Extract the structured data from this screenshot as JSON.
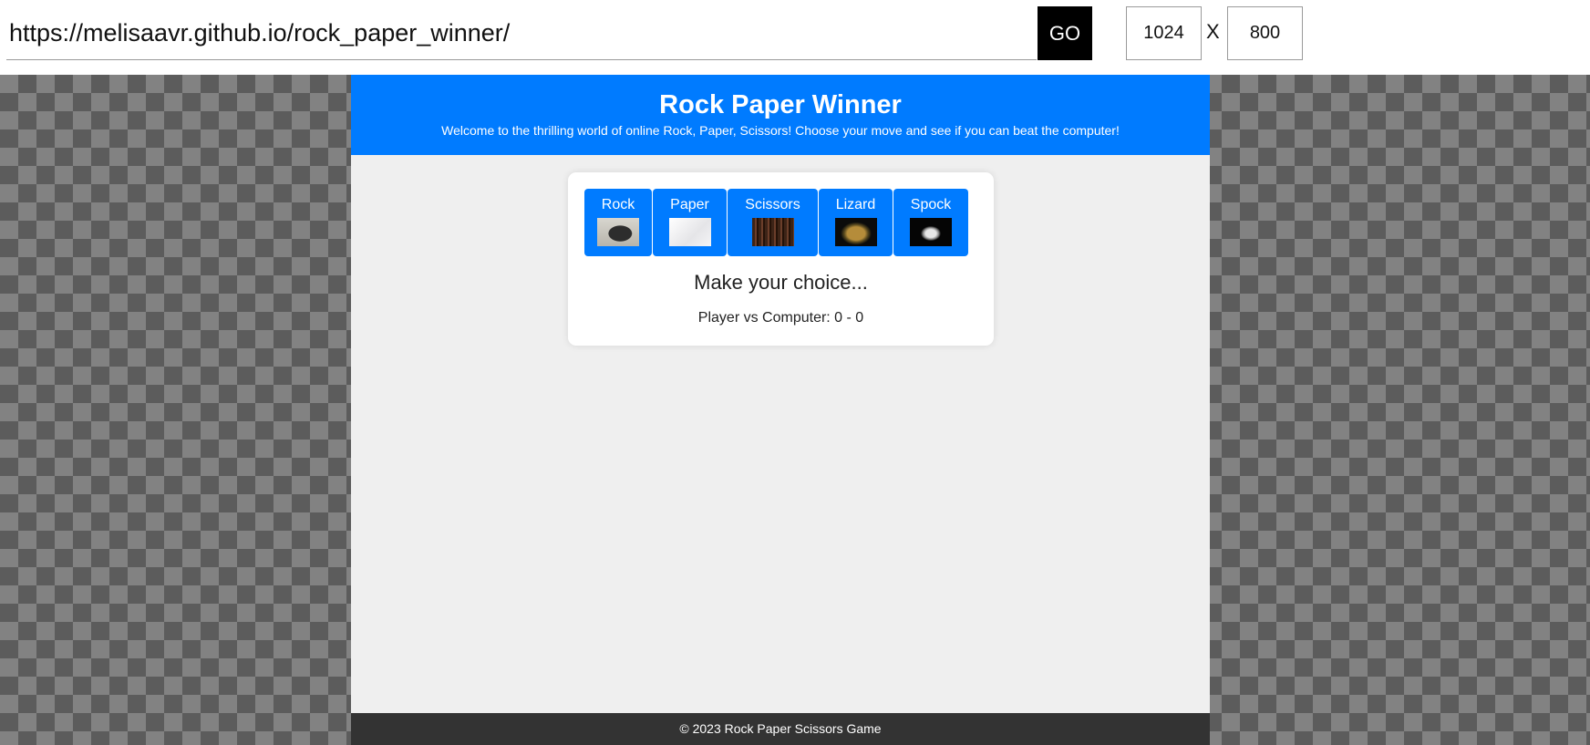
{
  "toolbar": {
    "url": "https://melisaavr.github.io/rock_paper_winner/",
    "go_label": "GO",
    "width_value": "1024",
    "separator": "X",
    "height_value": "800"
  },
  "site": {
    "title": "Rock Paper Winner",
    "subtitle": "Welcome to the thrilling world of online Rock, Paper, Scissors! Choose your move and see if you can beat the computer!",
    "choices": [
      {
        "label": "Rock",
        "image": "rock-image"
      },
      {
        "label": "Paper",
        "image": "paper-image"
      },
      {
        "label": "Scissors",
        "image": "scissors-image"
      },
      {
        "label": "Lizard",
        "image": "lizard-image"
      },
      {
        "label": "Spock",
        "image": "spock-hand-image"
      }
    ],
    "status": "Make your choice...",
    "score": "Player vs Computer: 0 - 0",
    "footer": "© 2023 Rock Paper Scissors Game"
  },
  "colors": {
    "header": "#007bff",
    "button": "#007bff",
    "footer": "#333333",
    "page_bg": "#efefef",
    "checker_dark": "#5c5c5c",
    "checker_light": "#828282"
  }
}
